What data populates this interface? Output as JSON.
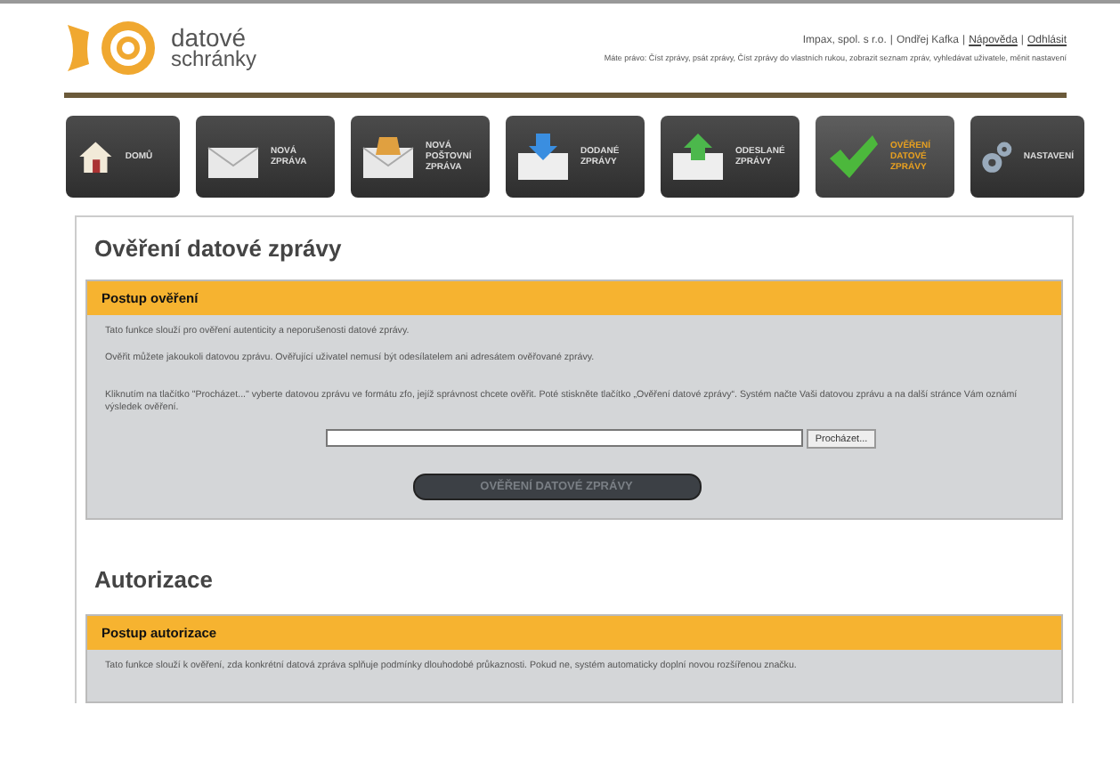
{
  "logo": {
    "line1": "datové",
    "line2": "schránky"
  },
  "user_bar": {
    "items": [
      {
        "kind": "text",
        "text": "Impax, spol. s r.o."
      },
      {
        "kind": "separator",
        "text": "|"
      },
      {
        "kind": "text",
        "text": "Ondřej Kafka"
      },
      {
        "kind": "separator",
        "text": "|"
      },
      {
        "kind": "link",
        "text": "Nápověda"
      },
      {
        "kind": "separator",
        "text": "|"
      },
      {
        "kind": "link",
        "text": "Odhlásit"
      }
    ],
    "rights": "Máte právo: Číst zprávy, psát zprávy, Číst zprávy do vlastních rukou, zobrazit seznam zpráv, vyhledávat uživatele, měnit nastavení"
  },
  "nav": [
    {
      "kind": "home",
      "label": "DOMŮ",
      "selected": false
    },
    {
      "kind": "new",
      "label": "NOVÁ ZPRÁVA",
      "selected": false
    },
    {
      "kind": "postal",
      "label": "NOVÁ POŠTOVNÍ ZPRÁVA",
      "selected": false
    },
    {
      "kind": "received",
      "label": "DODANÉ ZPRÁVY",
      "selected": false
    },
    {
      "kind": "sent",
      "label": "ODESLANÉ ZPRÁVY",
      "selected": false
    },
    {
      "kind": "verify",
      "label": "OVĚŘENÍ DATOVÉ ZPRÁVY",
      "selected": true
    },
    {
      "kind": "settings",
      "label": "NASTAVENÍ",
      "selected": false
    }
  ],
  "verify": {
    "title": "Ověření datové zprávy",
    "box_title": "Postup ověření",
    "paragraphs": [
      "Tato funkce slouží pro ověření autenticity a neporušenosti datové zprávy.",
      "Ověřit můžete jakoukoli datovou zprávu. Ověřující uživatel nemusí být odesílatelem ani adresátem ověřované zprávy.",
      "Kliknutím na tlačítko \"Procházet...\" vyberte datovou zprávu ve formátu zfo, jejíž správnost chcete ověřit. Poté stiskněte tlačítko „Ověření datové zprávy“. Systém načte Vaši datovou zprávu a na další stránce Vám oznámí výsledek ověření."
    ],
    "browse_button": "Procházet...",
    "submit_button": "OVĚŘENÍ DATOVÉ ZPRÁVY",
    "submit_disabled": true
  },
  "authorization": {
    "title": "Autorizace",
    "box_title": "Postup autorizace",
    "paragraphs": [
      "Tato funkce slouží k ověření, zda konkrétní datová zpráva splňuje podmínky dlouhodobé průkaznosti. Pokud ne, systém automaticky doplní novou rozšířenou značku."
    ]
  }
}
